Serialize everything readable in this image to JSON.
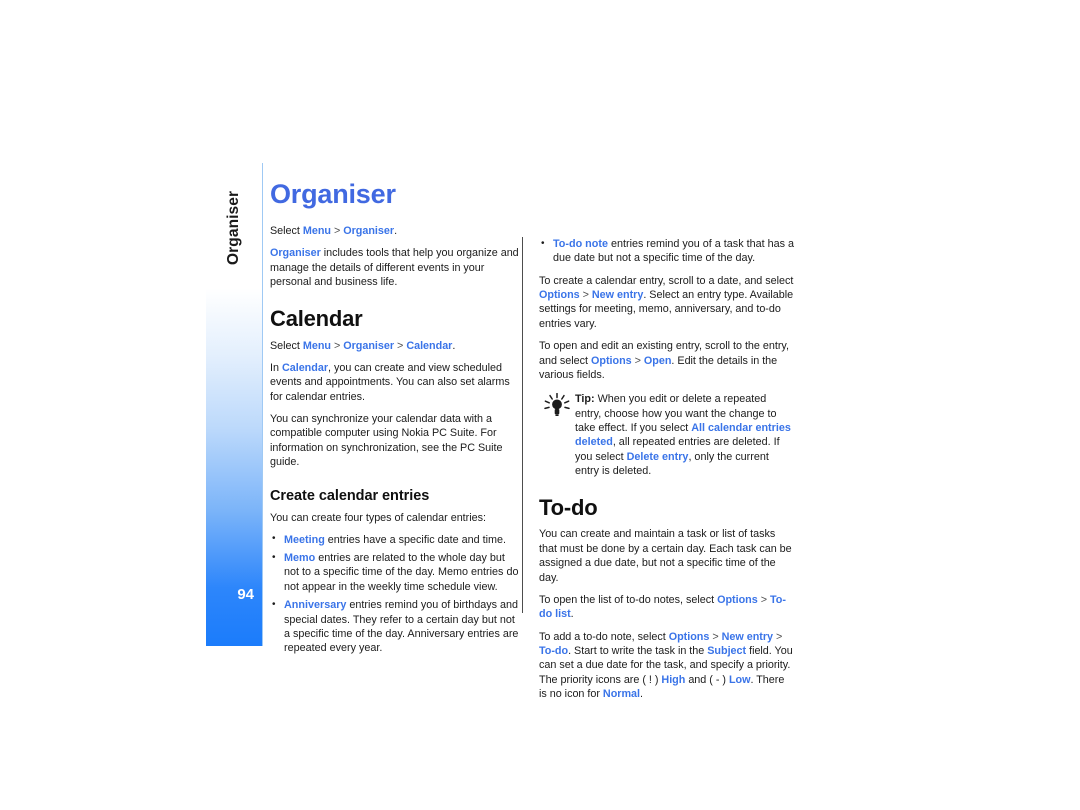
{
  "document": {
    "page_number": "94",
    "side_tab_label": "Organiser",
    "chapter_title": "Organiser"
  },
  "colors": {
    "chapter_title": "#4169e1",
    "ui_term": "#3a74e8",
    "body_text": "#1c1c1c",
    "tab_gradient_end": "#1b7cfb",
    "tab_rule": "#9fc9f4",
    "column_divider": "#4d4d4d"
  },
  "left_column": {
    "intro": {
      "select_lead": "Select ",
      "select_menu": "Menu",
      "select_sep": " > ",
      "select_organiser": "Organiser",
      "select_end": ".",
      "para_term": "Organiser",
      "para_rest": " includes tools that help you organize and manage the details of different events in your personal and business life."
    },
    "calendar": {
      "heading": "Calendar",
      "select_lead": "Select ",
      "select_menu": "Menu",
      "select_sep1": " > ",
      "select_organiser": "Organiser",
      "select_sep2": " > ",
      "select_calendar": "Calendar",
      "select_end": ".",
      "p1_lead": "In ",
      "p1_term": "Calendar",
      "p1_rest": ", you can create and view scheduled events and appointments. You can also set alarms for calendar entries.",
      "p2": "You can synchronize your calendar data with a compatible computer using Nokia PC Suite. For information on synchronization, see the PC Suite guide."
    },
    "create_entries": {
      "heading": "Create calendar entries",
      "intro": "You can create four types of calendar entries:",
      "bullets": [
        {
          "term": "Meeting",
          "rest": " entries have a specific date and time."
        },
        {
          "term": "Memo",
          "rest": " entries are related to the whole day but not to a specific time of the day. Memo entries do not appear in the weekly time schedule view."
        },
        {
          "term": "Anniversary",
          "rest": " entries remind you of birthdays and special dates. They refer to a certain day but not a specific time of the day. Anniversary entries are repeated every year."
        }
      ]
    }
  },
  "right_column": {
    "bullet_continued": {
      "term": "To-do note",
      "rest": " entries remind you of a task that has a due date but not a specific time of the day."
    },
    "create_entry_para": {
      "lead": "To create a calendar entry, scroll to a date, and select ",
      "ui1": "Options",
      "sep": " > ",
      "ui2": "New entry",
      "rest": ". Select an entry type. Available settings for meeting, memo, anniversary, and to-do entries vary."
    },
    "open_edit_para": {
      "lead": "To open and edit an existing entry, scroll to the entry, and select ",
      "ui1": "Options",
      "sep": " > ",
      "ui2": "Open",
      "rest": ". Edit the details in the various fields."
    },
    "tip": {
      "icon": "lightbulb-tip-icon",
      "label": "Tip:",
      "text_part1": " When you edit or delete a repeated entry, choose how you want the change to take effect. If you select ",
      "ui1": "All calendar entries deleted",
      "text_part2": ", all repeated entries are deleted. If you select ",
      "ui2": "Delete entry",
      "text_part3": ", only the current entry is deleted."
    },
    "todo": {
      "heading": "To-do",
      "p1": "You can create and maintain a task or list of tasks that must be done by a certain day. Each task can be assigned a due date, but not a specific time of the day.",
      "p2_lead": "To open the list of to-do notes, select ",
      "p2_ui1": "Options",
      "p2_sep": " > ",
      "p2_ui2": "To-do list",
      "p2_end": ".",
      "p3_lead": "To add a to-do note, select ",
      "p3_ui1": "Options",
      "p3_sep1": " > ",
      "p3_ui2": "New entry",
      "p3_sep2": " > ",
      "p3_ui3": "To-do",
      "p3_mid1": ". Start to write the task in the ",
      "p3_ui4": "Subject",
      "p3_mid2": " field. You can set a due date for the task, and specify a priority. The priority icons are ( ! ) ",
      "p3_ui5": "High",
      "p3_mid3": " and ( - ) ",
      "p3_ui6": "Low",
      "p3_mid4": ". There is no icon for ",
      "p3_ui7": "Normal",
      "p3_end": "."
    }
  }
}
